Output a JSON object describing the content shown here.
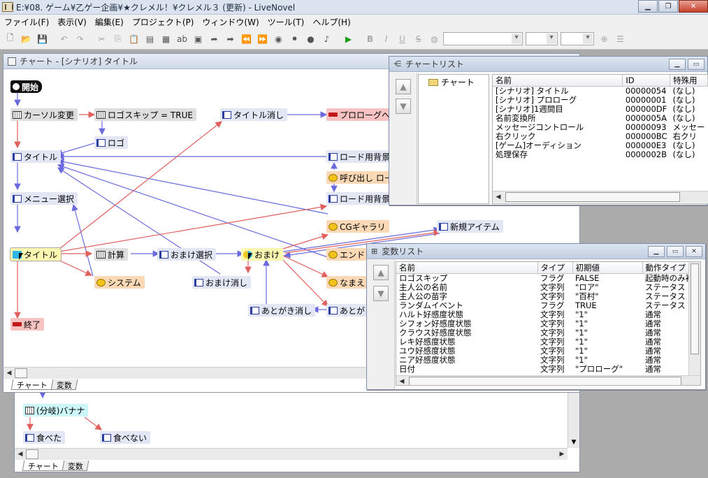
{
  "app": {
    "title": "E:¥08. ゲーム¥乙ゲー企画¥★クレメル！¥クレメル３ (更新) - LiveNovel"
  },
  "menu": [
    "ファイル(F)",
    "表示(V)",
    "編集(E)",
    "プロジェクト(P)",
    "ウィンドウ(W)",
    "ツール(T)",
    "ヘルプ(H)"
  ],
  "toolbar": {
    "bold": "B",
    "italic": "I",
    "underline": "U",
    "strike": "S"
  },
  "chart_window": {
    "title": "チャート - [シナリオ] タイトル",
    "tabs": [
      "チャート",
      "変数"
    ],
    "nodes": {
      "start": "開始",
      "cursor_change": "カーソル変更",
      "logo_skip": "ロゴスキップ = TRUE",
      "title_hide": "タイトル消し",
      "prologue": "プロローグへ",
      "logo": "ロゴ",
      "title1": "タイトル",
      "load_bg1": "ロード用背景消",
      "call_load": "呼び出し ロー",
      "menu_select": "メニュー選択",
      "load_bg2": "ロード用背景表",
      "cg_gallery": "CGギャラリ",
      "new_item": "新規アイテム",
      "title2": "タイトル",
      "calc": "計算",
      "bonus_select": "おまけ選択",
      "bonus": "おまけ",
      "ending": "エンドリ",
      "system": "システム",
      "bonus_hide": "おまけ消し",
      "name": "なまえ",
      "afterword_hide": "あとがき消し",
      "afterword": "あとがき",
      "end": "終了"
    }
  },
  "bottom_window": {
    "tabs": [
      "チャート",
      "変数"
    ],
    "nodes": {
      "branch": "(分岐)バナナ",
      "ate": "食べた",
      "not_ate": "食べない"
    }
  },
  "chart_list": {
    "title": "チャートリスト",
    "tree_root": "チャート",
    "columns": [
      "名前",
      "ID",
      "特殊用"
    ],
    "rows": [
      [
        "[シナリオ] タイトル",
        "00000054",
        "(なし)"
      ],
      [
        "[シナリオ] プロローグ",
        "00000001",
        "(なし)"
      ],
      [
        "[シナリオ]1週間目",
        "000000DF",
        "(なし)"
      ],
      [
        "名前変換所",
        "0000005A",
        "(なし)"
      ],
      [
        "メッセージコントロール",
        "00000093",
        "メッセー"
      ],
      [
        "右クリック",
        "000000BC",
        "右クリ"
      ],
      [
        "[ゲーム]オーディション",
        "000000E3",
        "(なし)"
      ],
      [
        "処理保存",
        "0000002B",
        "(なし)"
      ]
    ]
  },
  "var_list": {
    "title": "変数リスト",
    "columns": [
      "名前",
      "タイプ",
      "初期値",
      "動作タイプ"
    ],
    "rows": [
      [
        "ロゴスキップ",
        "フラグ",
        "FALSE",
        "起動時のみ初"
      ],
      [
        "主人公の名前",
        "文字列",
        "\"ロア\"",
        "ステータス"
      ],
      [
        "主人公の苗字",
        "文字列",
        "\"百村\"",
        "ステータス"
      ],
      [
        "ランダムイベント",
        "フラグ",
        "TRUE",
        "ステータス"
      ],
      [
        "ハルト好感度状態",
        "文字列",
        "\"1\"",
        "通常"
      ],
      [
        "シフォン好感度状態",
        "文字列",
        "\"1\"",
        "通常"
      ],
      [
        "クラウス好感度状態",
        "文字列",
        "\"1\"",
        "通常"
      ],
      [
        "レキ好感度状態",
        "文字列",
        "\"1\"",
        "通常"
      ],
      [
        "ユウ好感度状態",
        "文字列",
        "\"1\"",
        "通常"
      ],
      [
        "ニア好感度状態",
        "文字列",
        "\"1\"",
        "通常"
      ],
      [
        "日付",
        "文字列",
        "\"プロローグ\"",
        "通常"
      ]
    ]
  }
}
